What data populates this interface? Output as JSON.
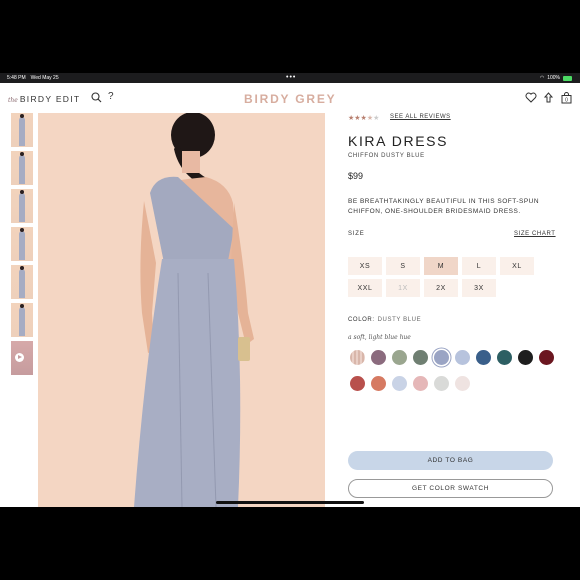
{
  "status": {
    "time": "5:48 PM",
    "date": "Wed May 25",
    "dots": "•••",
    "battery": "100%"
  },
  "header": {
    "edit_prefix": "the",
    "edit_label": "BIRDY EDIT",
    "logo": "BIRDY GREY",
    "icons": [
      "search-icon",
      "help-icon",
      "heart-icon",
      "account-icon",
      "bag-icon"
    ],
    "bag_count": "0"
  },
  "gallery": {
    "thumb_count": 7
  },
  "product": {
    "rating": 3.5,
    "stars": "★★★",
    "half": "★",
    "stars_off": "★",
    "see_reviews": "SEE ALL REVIEWS",
    "title": "KIRA DRESS",
    "subtitle": "CHIFFON DUSTY BLUE",
    "price": "$99",
    "description": "BE BREATHTAKINGLY BEAUTIFUL IN THIS SOFT-SPUN CHIFFON, ONE-SHOULDER BRIDESMAID DRESS.",
    "size_label": "SIZE",
    "size_chart": "SIZE CHART",
    "sizes": [
      "XS",
      "S",
      "M",
      "L",
      "XL",
      "XXL",
      "1X",
      "2X",
      "3X"
    ],
    "selected_size": "M",
    "unavailable_sizes": [
      "1X"
    ],
    "color_label": "COLOR:",
    "color_value": "DUSTY BLUE",
    "color_note": "a soft, light blue hue",
    "swatches": [
      "#d8b6aa",
      "#8b6b7e",
      "#9aa68f",
      "#6f7f72",
      "#9aa4c4",
      "#b7c3dd",
      "#3a5f8a",
      "#2d5f63",
      "#1e1e1e",
      "#6b1620",
      "#b8504c",
      "#d67a62",
      "#c9d3e6",
      "#e5b7b8",
      "#d9dad8",
      "#efe3e1"
    ],
    "selected_swatch_index": 4,
    "add_to_bag": "ADD TO BAG",
    "get_swatch": "GET COLOR SWATCH"
  }
}
